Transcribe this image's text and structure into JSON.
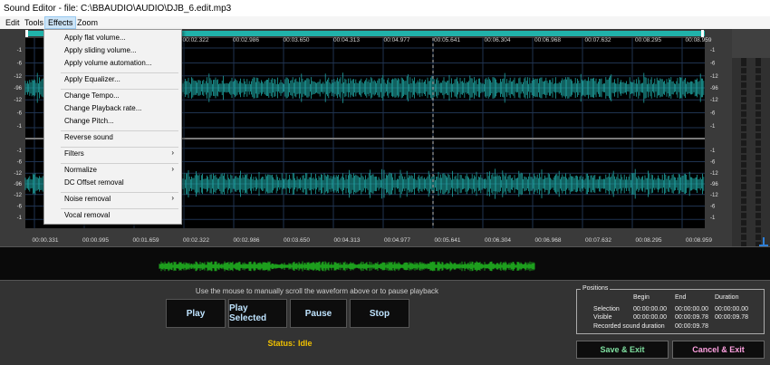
{
  "window": {
    "title": "Sound Editor - file: C:\\BBAUDIO\\AUDIO\\DJB_6.edit.mp3"
  },
  "menu": {
    "items": [
      "Edit",
      "Tools",
      "Effects",
      "Zoom"
    ],
    "active": "Effects"
  },
  "effects_menu": {
    "items": [
      {
        "label": "Apply flat volume..."
      },
      {
        "label": "Apply sliding volume..."
      },
      {
        "label": "Apply volume automation..."
      },
      {
        "label": "Apply Equalizer..."
      },
      {
        "label": "Change Tempo..."
      },
      {
        "label": "Change Playback rate..."
      },
      {
        "label": "Change Pitch..."
      },
      {
        "label": "Reverse sound"
      },
      {
        "label": "Filters",
        "submenu": true
      },
      {
        "label": "Normalize",
        "submenu": true
      },
      {
        "label": "DC Offset removal"
      },
      {
        "label": "Noise removal",
        "submenu": true
      },
      {
        "label": "Vocal removal"
      }
    ],
    "submenu_arrow": "›"
  },
  "timeline": {
    "top_labels": [
      "00:02.322",
      "00:02.986",
      "00:03.650",
      "00:04.313",
      "00:04.977",
      "00:05.641",
      "00:06.304",
      "00:06.968",
      "00:07.632",
      "00:08.295",
      "00:08.959"
    ],
    "bottom_labels": [
      "00:00.331",
      "00:00.995",
      "00:01.659",
      "00:02.322",
      "00:02.986",
      "00:03.650",
      "00:04.313",
      "00:04.977",
      "00:05.641",
      "00:06.304",
      "00:06.968",
      "00:07.632",
      "00:08.295",
      "00:08.959"
    ]
  },
  "db_scale": {
    "channel_labels": [
      "-1",
      "-6",
      "-12",
      "-96",
      "-12",
      "-6",
      "-1"
    ]
  },
  "colors": {
    "waveform": "#1fa3a0",
    "overview_wave": "#22c422",
    "timeline_bar": "#20b2aa",
    "status": "#f0c000",
    "play_text": "#bfe4ff",
    "save_text": "#7fe0a0",
    "cancel_text": "#ffa0e0"
  },
  "controls": {
    "hint": "Use the mouse to manually scroll the waveform above or to pause playback",
    "play": "Play",
    "play_selected": "Play Selected",
    "pause": "Pause",
    "stop": "Stop",
    "status_label": "Status:",
    "status_value": "Idle"
  },
  "positions": {
    "title": "Positions",
    "headers": [
      "Begin",
      "End",
      "Duration"
    ],
    "rows": [
      {
        "label": "Selection",
        "begin": "00:00:00.00",
        "end": "00:00:00.00",
        "duration": "00:00:00.00"
      },
      {
        "label": "Visible",
        "begin": "00:00:00.00",
        "end": "00:00:09.78",
        "duration": "00:00:09.78"
      }
    ],
    "recorded_label": "Recorded sound duration",
    "recorded_value": "00:00:09.78"
  },
  "actions": {
    "save": "Save & Exit",
    "cancel": "Cancel & Exit"
  }
}
